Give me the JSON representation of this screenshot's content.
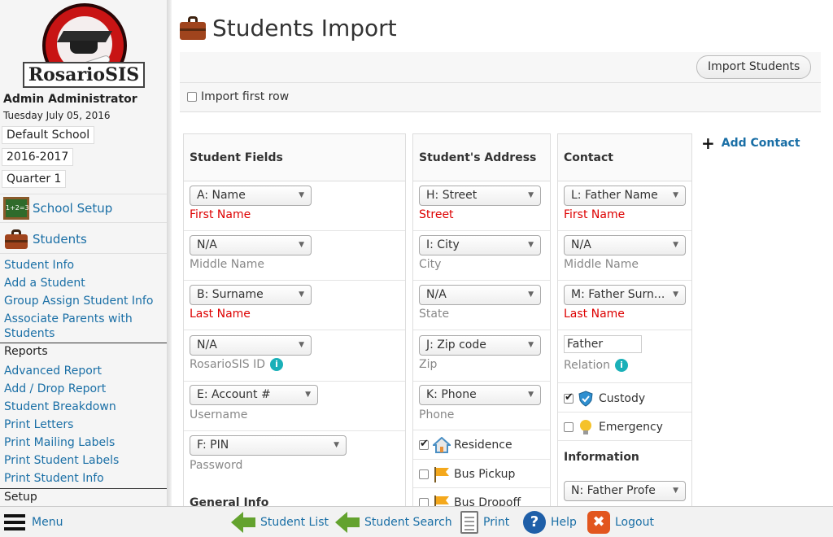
{
  "sidebar": {
    "logo_text": "RosarioSIS",
    "user_name": "Admin Administrator",
    "date": "Tuesday July 05, 2016",
    "school": "Default School",
    "year": "2016-2017",
    "quarter": "Quarter 1",
    "school_setup": "School Setup",
    "students": "Students",
    "links": [
      "Student Info",
      "Add a Student",
      "Group Assign Student Info",
      "Associate Parents with Students"
    ],
    "reports_header": "Reports",
    "report_links": [
      "Advanced Report",
      "Add / Drop Report",
      "Student Breakdown",
      "Print Letters",
      "Print Mailing Labels",
      "Print Student Labels",
      "Print Student Info"
    ],
    "setup_header": "Setup"
  },
  "main": {
    "title": "Students Import",
    "import_button": "Import Students",
    "import_first_row": "Import first row",
    "add_contact": "Add Contact"
  },
  "student_fields": {
    "header": "Student Fields",
    "rows": [
      {
        "select": "A: Name",
        "label": "First Name"
      },
      {
        "select": "N/A",
        "label": "Middle Name"
      },
      {
        "select": "B: Surname",
        "label": "Last Name"
      },
      {
        "select": "N/A",
        "label": "RosarioSIS ID"
      },
      {
        "select": "E: Account #",
        "label": "Username"
      },
      {
        "select": "F: PIN",
        "label": "Password"
      }
    ],
    "general_info": "General Info"
  },
  "address": {
    "header": "Student's Address",
    "rows": [
      {
        "select": "H: Street",
        "label": "Street"
      },
      {
        "select": "I: City",
        "label": "City"
      },
      {
        "select": "N/A",
        "label": "State"
      },
      {
        "select": "J: Zip code",
        "label": "Zip"
      },
      {
        "select": "K: Phone",
        "label": "Phone"
      }
    ],
    "residence": "Residence",
    "bus_pickup": "Bus Pickup",
    "bus_dropoff": "Bus Dropoff"
  },
  "contact": {
    "header": "Contact",
    "rows": [
      {
        "select": "L: Father Name",
        "label": "First Name"
      },
      {
        "select": "N/A",
        "label": "Middle Name"
      },
      {
        "select": "M: Father Surn...",
        "label": "Last Name"
      }
    ],
    "relation_value": "Father",
    "relation_label": "Relation",
    "custody": "Custody",
    "emergency": "Emergency",
    "information": "Information",
    "info_select": "N: Father Profe"
  },
  "bottombar": {
    "menu": "Menu",
    "student_list": "Student List",
    "student_search": "Student Search",
    "print": "Print",
    "help": "Help",
    "logout": "Logout"
  },
  "icons": {
    "info": "i",
    "help": "?",
    "logout": "✖",
    "arrow": "▼",
    "plus": "+"
  }
}
